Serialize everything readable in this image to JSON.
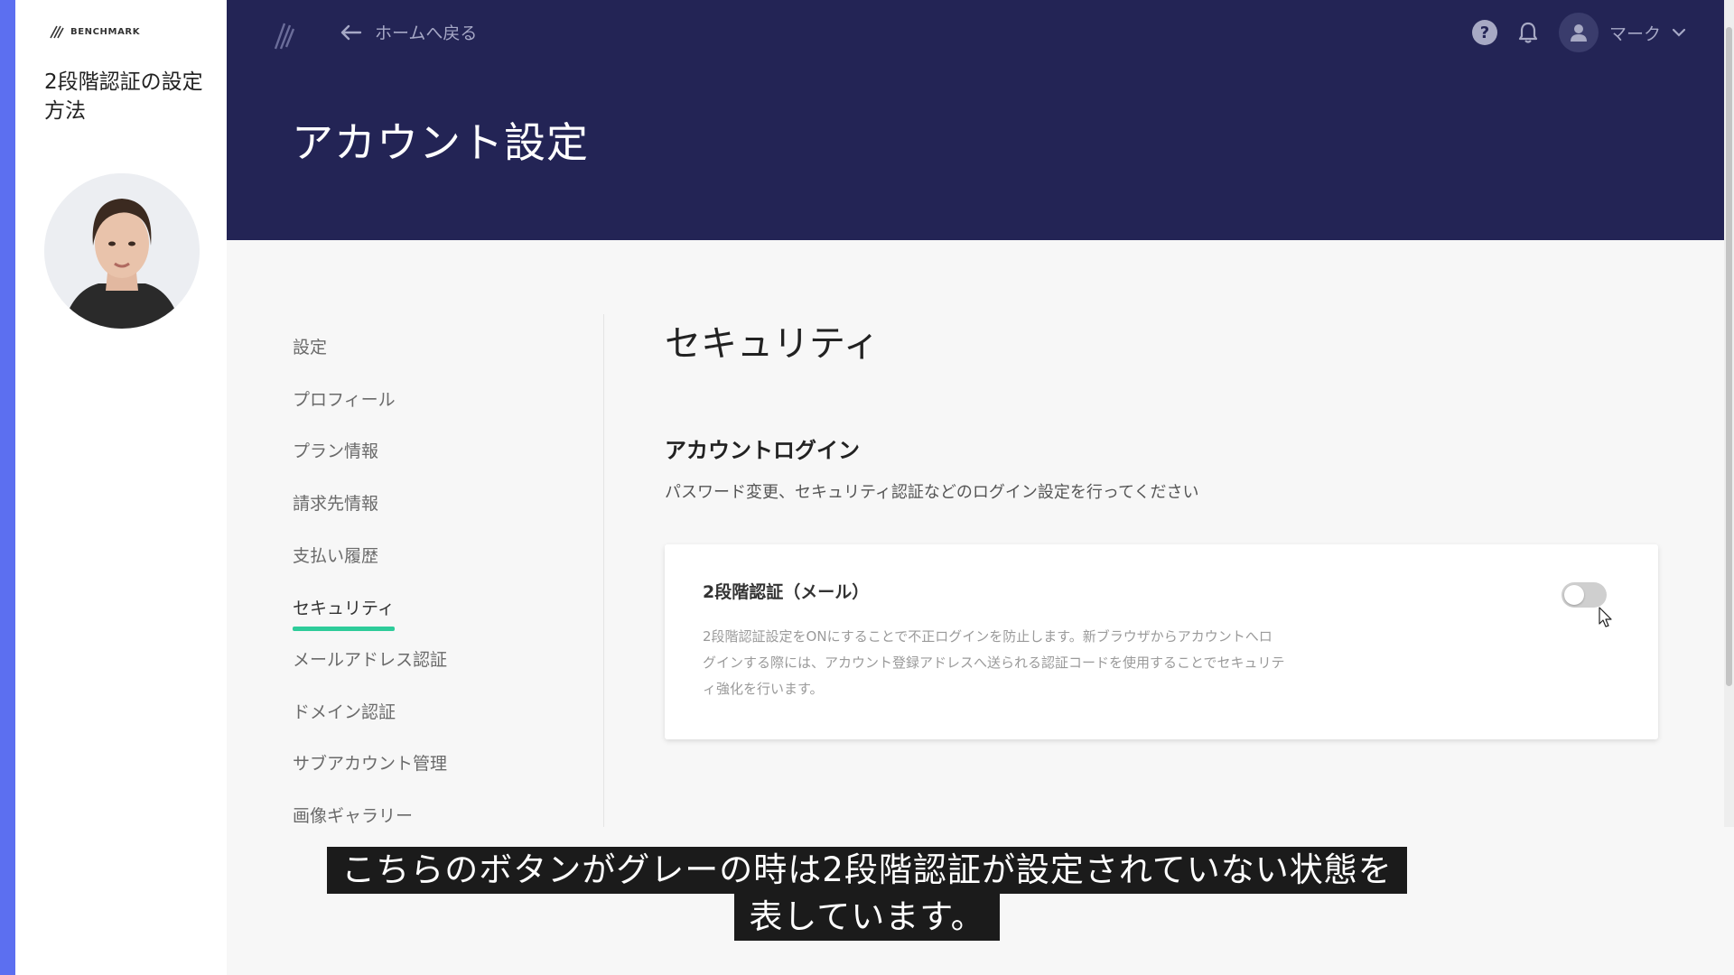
{
  "brand": {
    "name": "BENCHMARK"
  },
  "lesson": {
    "title": "2段階認証の設定方法"
  },
  "header": {
    "back_label": "ホームへ戻る",
    "title": "アカウント設定",
    "user_name": "マーク"
  },
  "nav": {
    "items": [
      {
        "label": "設定"
      },
      {
        "label": "プロフィール"
      },
      {
        "label": "プラン情報"
      },
      {
        "label": "請求先情報"
      },
      {
        "label": "支払い履歴"
      },
      {
        "label": "セキュリティ",
        "active": true
      },
      {
        "label": "メールアドレス認証"
      },
      {
        "label": "ドメイン認証"
      },
      {
        "label": "サブアカウント管理"
      },
      {
        "label": "画像ギャラリー"
      }
    ]
  },
  "security": {
    "title": "セキュリティ",
    "login_title": "アカウントログイン",
    "login_desc": "パスワード変更、セキュリティ認証などのログイン設定を行ってください",
    "two_factor": {
      "title": "2段階認証（メール）",
      "desc_lines": [
        "2段階認証設定をONにすることで不正ログインを防止します。新ブラウザからアカウントへロ",
        "グインする際には、アカウント登録アドレスへ送られる認証コードを使用することでセキュリテ",
        "ィ強化を行います。"
      ],
      "enabled": false
    }
  },
  "subtitle": {
    "line1": "こちらのボタンがグレーの時は2段階認証が設定されていない状態を",
    "line2": "表しています。"
  },
  "colors": {
    "header_bg": "#232455",
    "left_strip": "#5c6ff0",
    "accent_tab": "#2ecc9a",
    "toggle_off": "#cfcfcf"
  }
}
